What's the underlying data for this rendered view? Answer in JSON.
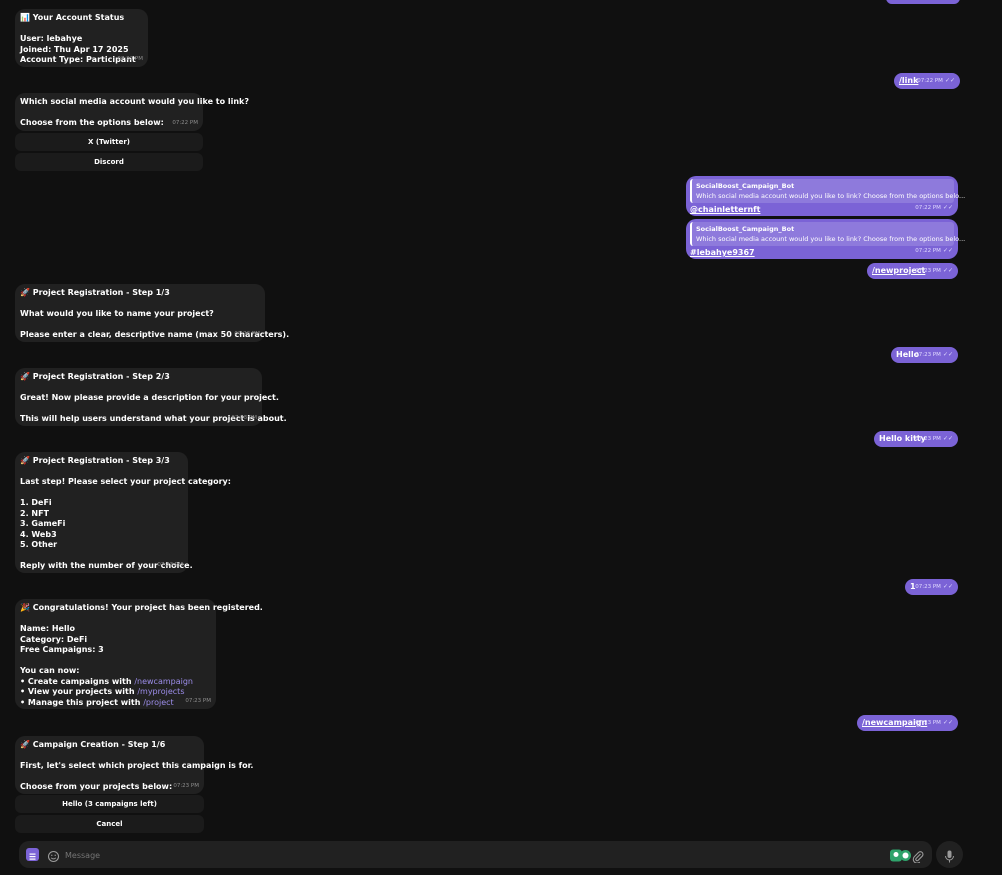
{
  "colors": {
    "background": "#101010",
    "bot_bubble": "#212121",
    "user_bubble": "#7b63d6",
    "accent": "#9c8dea"
  },
  "messages": {
    "status": {
      "title": "📊 Your Account Status",
      "user": "User: lebahye",
      "joined": "Joined: Thu Apr 17 2025",
      "type": "Account Type: Participant",
      "time": "07:22 PM"
    },
    "link_cmd": {
      "text": "/link",
      "time": "07:22 PM"
    },
    "link_prompt": {
      "line1": "Which social media account would you like to link?",
      "line2": "Choose from the options below:",
      "time": "07:22 PM",
      "buttons": [
        "X (Twitter)",
        "Discord"
      ]
    },
    "reply1": {
      "name": "SocialBoost_Campaign_Bot",
      "quote": "Which social media account would you like to link? Choose from the options belo...",
      "text": "@chainletternft",
      "time": "07:22 PM"
    },
    "reply2": {
      "name": "SocialBoost_Campaign_Bot",
      "quote": "Which social media account would you like to link? Choose from the options belo...",
      "text": "#lebahye9367",
      "time": "07:22 PM"
    },
    "newproject_cmd": {
      "text": "/newproject",
      "time": "07:23 PM"
    },
    "step1": {
      "title": "🚀 Project Registration - Step 1/3",
      "line1": "What would you like to name your project?",
      "line2": "Please enter a clear, descriptive name (max 50 characters).",
      "time": "07:23 PM"
    },
    "hello": {
      "text": "Hello",
      "time": "07:23 PM"
    },
    "step2": {
      "title": "🚀 Project Registration - Step 2/3",
      "line1": "Great! Now please provide a description for your project.",
      "line2": "This will help users understand what your project is about.",
      "time": "07:23 PM"
    },
    "hello_kitty": {
      "text": "Hello kitty",
      "time": "07:23 PM"
    },
    "step3": {
      "title": "🚀 Project Registration - Step 3/3",
      "line1": "Last step! Please select your project category:",
      "options": [
        "1. DeFi",
        "2. NFT",
        "3. GameFi",
        "4. Web3",
        "5. Other"
      ],
      "line2": "Reply with the number of your choice.",
      "time": "07:23 PM"
    },
    "one": {
      "text": "1",
      "time": "07:23 PM"
    },
    "congrats": {
      "title": "🎉 Congratulations! Your project has been registered.",
      "name": "Name: Hello",
      "category": "Category: DeFi",
      "free": "Free Campaigns: 3",
      "can": "You can now:",
      "b1_pre": "• Create campaigns with ",
      "b1_cmd": "/newcampaign",
      "b2_pre": "• View your projects with ",
      "b2_cmd": "/myprojects",
      "b3_pre": "• Manage this project with ",
      "b3_cmd": "/project",
      "time": "07:23 PM"
    },
    "newcampaign_cmd": {
      "text": "/newcampaign",
      "time": "07:23 PM"
    },
    "campaign": {
      "title": "🚀 Campaign Creation - Step 1/6",
      "line1": "First, let's select which project this campaign is for.",
      "line2": "Choose from your projects below:",
      "time": "07:23 PM",
      "buttons": [
        "Hello (3 campaigns left)",
        "Cancel"
      ]
    }
  },
  "composer": {
    "placeholder": "Message"
  },
  "icons": [
    "bot-menu-icon",
    "emoji-icon",
    "extension-icon",
    "attach-icon",
    "mic-icon",
    "read-check-icon"
  ]
}
